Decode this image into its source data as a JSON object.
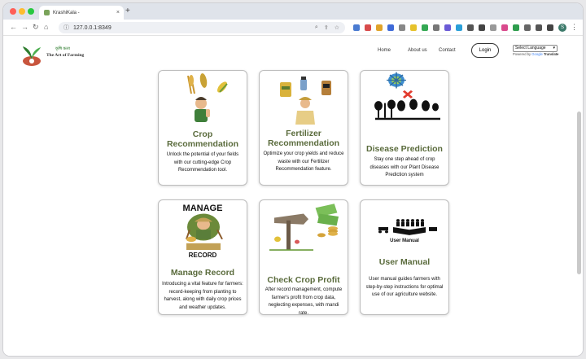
{
  "browser": {
    "tab_title": "KrashiKala -",
    "tab_close": "×",
    "new_tab": "+",
    "url": "127.0.0.1:8349",
    "avatar_letter": "S"
  },
  "site": {
    "brand_hindi": "कृषि कला",
    "brand_english": "The Art of Farming",
    "nav": [
      "Home",
      "About us",
      "Contact"
    ],
    "login_label": "Login",
    "language_select": "Select Language",
    "powered_by": "Powered by",
    "google": "Google",
    "translate": "Translate"
  },
  "cards": [
    {
      "title": "Crop Recommendation",
      "description": "Unlock the potential of your fields with our cutting-edge Crop Recommendation tool."
    },
    {
      "title": "Fertilizer Recommendation",
      "description": "Optimize your crop yields and reduce waste with our Fertilizer Recommendation feature."
    },
    {
      "title": "Disease Prediction",
      "description": "Stay one step ahead of crop diseases with our Plant Disease Prediction system"
    },
    {
      "title": "Manage Record",
      "description": "Introducing a vital feature for farmers: record-keeping from planting to harvest, along with daily crop prices and weather updates.",
      "art_top": "MANAGE",
      "art_bottom": "RECORD"
    },
    {
      "title": "Check Crop Profit",
      "description": "After record management, compute farmer's profit from crop data, neglecting expenses, with mandi rate."
    },
    {
      "title": "User Manual",
      "description": "User manual guides farmers with step-by-step instructions for optimal use of our agriculture website.",
      "art_caption": "User Manual"
    }
  ],
  "colors": {
    "card_title": "#5a6b3c",
    "accent": "#2f7d2f"
  }
}
